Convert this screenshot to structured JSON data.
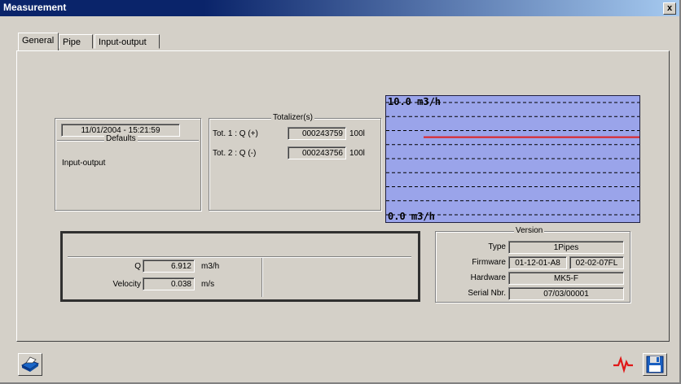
{
  "window": {
    "title": "Measurement",
    "close_label": "x"
  },
  "tabs": [
    {
      "label": "General",
      "active": true
    },
    {
      "label": "Pipe",
      "active": false
    },
    {
      "label": "Input-output",
      "active": false
    }
  ],
  "defaults": {
    "datetime": "11/01/2004 - 15:21:59",
    "title": "Defaults",
    "value": "Input-output"
  },
  "totalizer": {
    "title": "Totalizer(s)",
    "rows": [
      {
        "label": "Tot. 1 : Q (+)",
        "value": "000243759",
        "unit": "100l"
      },
      {
        "label": "Tot. 2 : Q (-)",
        "value": "000243756",
        "unit": "100l"
      }
    ]
  },
  "graph": {
    "max_label": "10.0 m3/h",
    "min_label": "0.0 m3/h",
    "bg_color": "#9aa4ea",
    "trace_color": "#e02020",
    "trace_value": 6.912,
    "range": [
      0,
      10
    ]
  },
  "measurements": [
    {
      "label": "Q",
      "value": "6.912",
      "unit": "m3/h"
    },
    {
      "label": "Velocity",
      "value": "0.038",
      "unit": "m/s"
    }
  ],
  "version": {
    "title": "Version",
    "type_label": "Type",
    "type_value": "1Pipes",
    "firmware_label": "Firmware",
    "firmware_value1": "01-12-01-A8",
    "firmware_value2": "02-02-07FL",
    "hardware_label": "Hardware",
    "hardware_value": "MK5-F",
    "serial_label": "Serial Nbr.",
    "serial_value": "07/03/00001"
  },
  "icons": {
    "print": "printer-icon",
    "signal": "signal-waveform-icon",
    "save": "floppy-disk-icon"
  }
}
